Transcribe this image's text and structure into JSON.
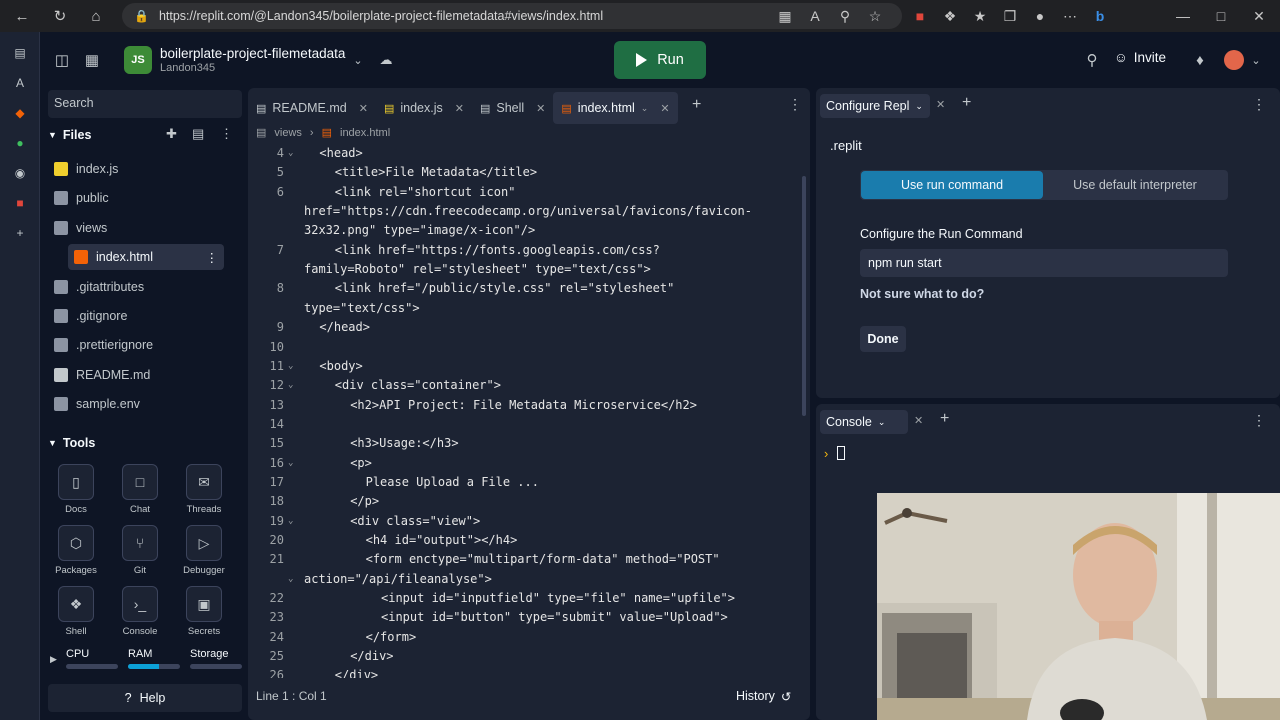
{
  "browser": {
    "url": "https://replit.com/@Landon345/boilerplate-project-filemetadata#views/index.html"
  },
  "header": {
    "repl_name": "boilerplate-project-filemetadata",
    "owner": "Landon345",
    "run_label": "Run",
    "invite_label": "Invite"
  },
  "sidebar": {
    "search_placeholder": "Search",
    "files_title": "Files",
    "files": [
      {
        "name": "index.js",
        "icon": "js-file-icon"
      },
      {
        "name": "public",
        "icon": "folder-icon"
      },
      {
        "name": "views",
        "icon": "folder-open-icon"
      },
      {
        "name": "index.html",
        "icon": "html-file-icon"
      },
      {
        "name": ".gitattributes",
        "icon": "file-icon"
      },
      {
        "name": ".gitignore",
        "icon": "file-icon"
      },
      {
        "name": ".prettierignore",
        "icon": "file-icon"
      },
      {
        "name": "README.md",
        "icon": "markdown-file-icon"
      },
      {
        "name": "sample.env",
        "icon": "file-icon"
      }
    ],
    "tools_title": "Tools",
    "tools": [
      {
        "label": "Docs",
        "icon": "docs-icon"
      },
      {
        "label": "Chat",
        "icon": "chat-icon"
      },
      {
        "label": "Threads",
        "icon": "threads-icon"
      },
      {
        "label": "Packages",
        "icon": "packages-icon"
      },
      {
        "label": "Git",
        "icon": "git-icon"
      },
      {
        "label": "Debugger",
        "icon": "debugger-icon"
      },
      {
        "label": "Shell",
        "icon": "shell-icon"
      },
      {
        "label": "Console",
        "icon": "console-icon"
      },
      {
        "label": "Secrets",
        "icon": "lock-icon"
      }
    ],
    "meters": [
      {
        "label": "CPU",
        "value": 0.0
      },
      {
        "label": "RAM",
        "value": 0.6
      },
      {
        "label": "Storage",
        "value": 0.0
      }
    ],
    "help_label": "Help"
  },
  "editor": {
    "tabs": [
      "README.md",
      "index.js",
      "Shell",
      "index.html"
    ],
    "breadcrumb": [
      "views",
      "index.html"
    ],
    "status": "Line 1 : Col 1",
    "history_label": "History",
    "lines": [
      {
        "n": "4",
        "fold": true,
        "indent": 2,
        "text": "<head>"
      },
      {
        "n": "5",
        "fold": false,
        "indent": 4,
        "text": "<title>File Metadata</title>"
      },
      {
        "n": "6",
        "fold": false,
        "indent": 4,
        "text": "<link rel=\"shortcut icon\""
      },
      {
        "n": "",
        "fold": false,
        "indent": 0,
        "text": "href=\"https://cdn.freecodecamp.org/universal/favicons/favicon-"
      },
      {
        "n": "",
        "fold": false,
        "indent": 0,
        "text": "32x32.png\" type=\"image/x-icon\"/>"
      },
      {
        "n": "7",
        "fold": false,
        "indent": 4,
        "text": "<link href=\"https://fonts.googleapis.com/css?"
      },
      {
        "n": "",
        "fold": false,
        "indent": 0,
        "text": "family=Roboto\" rel=\"stylesheet\" type=\"text/css\">"
      },
      {
        "n": "8",
        "fold": false,
        "indent": 4,
        "text": "<link href=\"/public/style.css\" rel=\"stylesheet\""
      },
      {
        "n": "",
        "fold": false,
        "indent": 0,
        "text": "type=\"text/css\">"
      },
      {
        "n": "9",
        "fold": false,
        "indent": 2,
        "text": "</head>"
      },
      {
        "n": "10",
        "fold": false,
        "indent": 0,
        "text": ""
      },
      {
        "n": "11",
        "fold": true,
        "indent": 2,
        "text": "<body>"
      },
      {
        "n": "12",
        "fold": true,
        "indent": 4,
        "text": "<div class=\"container\">"
      },
      {
        "n": "13",
        "fold": false,
        "indent": 6,
        "text": "<h2>API Project: File Metadata Microservice</h2>"
      },
      {
        "n": "14",
        "fold": false,
        "indent": 0,
        "text": ""
      },
      {
        "n": "15",
        "fold": false,
        "indent": 6,
        "text": "<h3>Usage:</h3>"
      },
      {
        "n": "16",
        "fold": true,
        "indent": 6,
        "text": "<p>"
      },
      {
        "n": "17",
        "fold": false,
        "indent": 8,
        "text": "Please Upload a File ..."
      },
      {
        "n": "18",
        "fold": false,
        "indent": 6,
        "text": "</p>"
      },
      {
        "n": "19",
        "fold": true,
        "indent": 6,
        "text": "<div class=\"view\">"
      },
      {
        "n": "20",
        "fold": false,
        "indent": 8,
        "text": "<h4 id=\"output\"></h4>"
      },
      {
        "n": "21",
        "fold": false,
        "indent": 8,
        "text": "<form enctype=\"multipart/form-data\" method=\"POST\""
      },
      {
        "n": "",
        "fold": true,
        "indent": 0,
        "text": "action=\"/api/fileanalyse\">"
      },
      {
        "n": "22",
        "fold": false,
        "indent": 10,
        "text": "<input id=\"inputfield\" type=\"file\" name=\"upfile\">"
      },
      {
        "n": "23",
        "fold": false,
        "indent": 10,
        "text": "<input id=\"button\" type=\"submit\" value=\"Upload\">"
      },
      {
        "n": "24",
        "fold": false,
        "indent": 8,
        "text": "</form>"
      },
      {
        "n": "25",
        "fold": false,
        "indent": 6,
        "text": "</div>"
      },
      {
        "n": "26",
        "fold": false,
        "indent": 4,
        "text": "</div>"
      }
    ]
  },
  "config": {
    "tab_label": "Configure Repl",
    "file_label": ".replit",
    "option_active": "Use run command",
    "option_inactive": "Use default interpreter",
    "command_heading": "Configure the Run Command",
    "command_value": "npm run start",
    "help_link": "Not sure what to do?",
    "done_label": "Done"
  },
  "console": {
    "tab_label": "Console",
    "prompt": "›"
  },
  "colors": {
    "accent": "#0079f2",
    "active_segment": "#1a7cad",
    "run_button": "#1f6e43",
    "bg": "#0e1525",
    "panel": "#1c2333"
  }
}
